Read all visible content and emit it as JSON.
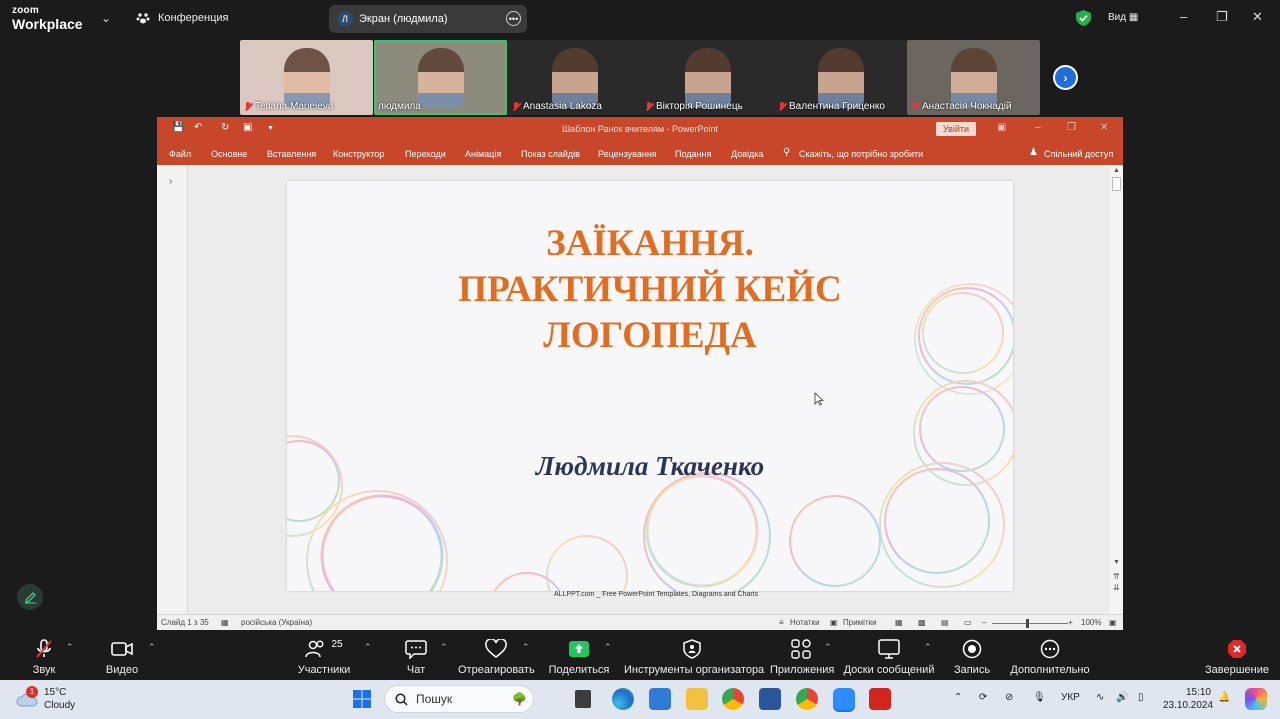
{
  "zoom": {
    "logo_line1": "zoom",
    "logo_line2": "Workplace",
    "meeting_label": "Конференция",
    "screen_share": {
      "avatar_letter": "Л",
      "label": "Экран (людмила)"
    },
    "view_label": "Вид",
    "participants": [
      {
        "name": "Tetiana Marieieva",
        "muted": true,
        "bg": "#d9c7c0"
      },
      {
        "name": "людмила",
        "muted": false,
        "bg": "#8d8a7e",
        "active": true
      },
      {
        "name": "Anastasia Lakoza",
        "muted": true,
        "bg": "#2a2a2a"
      },
      {
        "name": "Вікторія Рошинець",
        "muted": true,
        "bg": "#2a2a2a"
      },
      {
        "name": "Валентина Гриценко",
        "muted": true,
        "bg": "#2a2a2a"
      },
      {
        "name": "Анастасія Чокнадій",
        "muted": true,
        "bg": "#6b6660"
      }
    ],
    "toolbar": {
      "audio": "Звук",
      "video": "Видео",
      "participants": "Участники",
      "participants_count": "25",
      "chat": "Чат",
      "react": "Отреагировать",
      "share": "Поделиться",
      "host_tools": "Инструменты организатора",
      "apps": "Приложения",
      "whiteboards": "Доски сообщений",
      "record": "Запись",
      "more": "Дополнительно",
      "end": "Завершение"
    }
  },
  "powerpoint": {
    "window_title": "Шаблон Ранок вчителям  -  PowerPoint",
    "sign_in": "Увійти",
    "tabs": [
      "Файл",
      "Основне",
      "Вставлення",
      "Конструктор",
      "Переходи",
      "Анімація",
      "Показ слайдів",
      "Рецензування",
      "Подання",
      "Довідка"
    ],
    "tell_me": "Скажіть, що потрібно зробити",
    "share": "Спільний доступ",
    "slide": {
      "title_lines": [
        "ЗАЇКАННЯ.",
        "ПРАКТИЧНИЙ КЕЙС",
        "ЛОГОПЕДА"
      ],
      "author": "Людмила Ткаченко"
    },
    "footer_note": "ALLPPT.com _ Free PowerPoint Templates, Diagrams and Charts",
    "status": {
      "slide_counter": "Слайд 1 з 35",
      "language": "російська (Україна)",
      "notes": "Нотатки",
      "comments": "Примітки",
      "zoom": "100%"
    },
    "colors": {
      "ribbon": "#c8462a",
      "title": "#e36c1e",
      "author": "#2b3556"
    }
  },
  "taskbar": {
    "weather": {
      "temp": "15°C",
      "condition": "Cloudy",
      "badge": "1"
    },
    "search_placeholder": "Пошук",
    "language": "УКР",
    "time": "15:10",
    "date": "23.10.2024"
  }
}
